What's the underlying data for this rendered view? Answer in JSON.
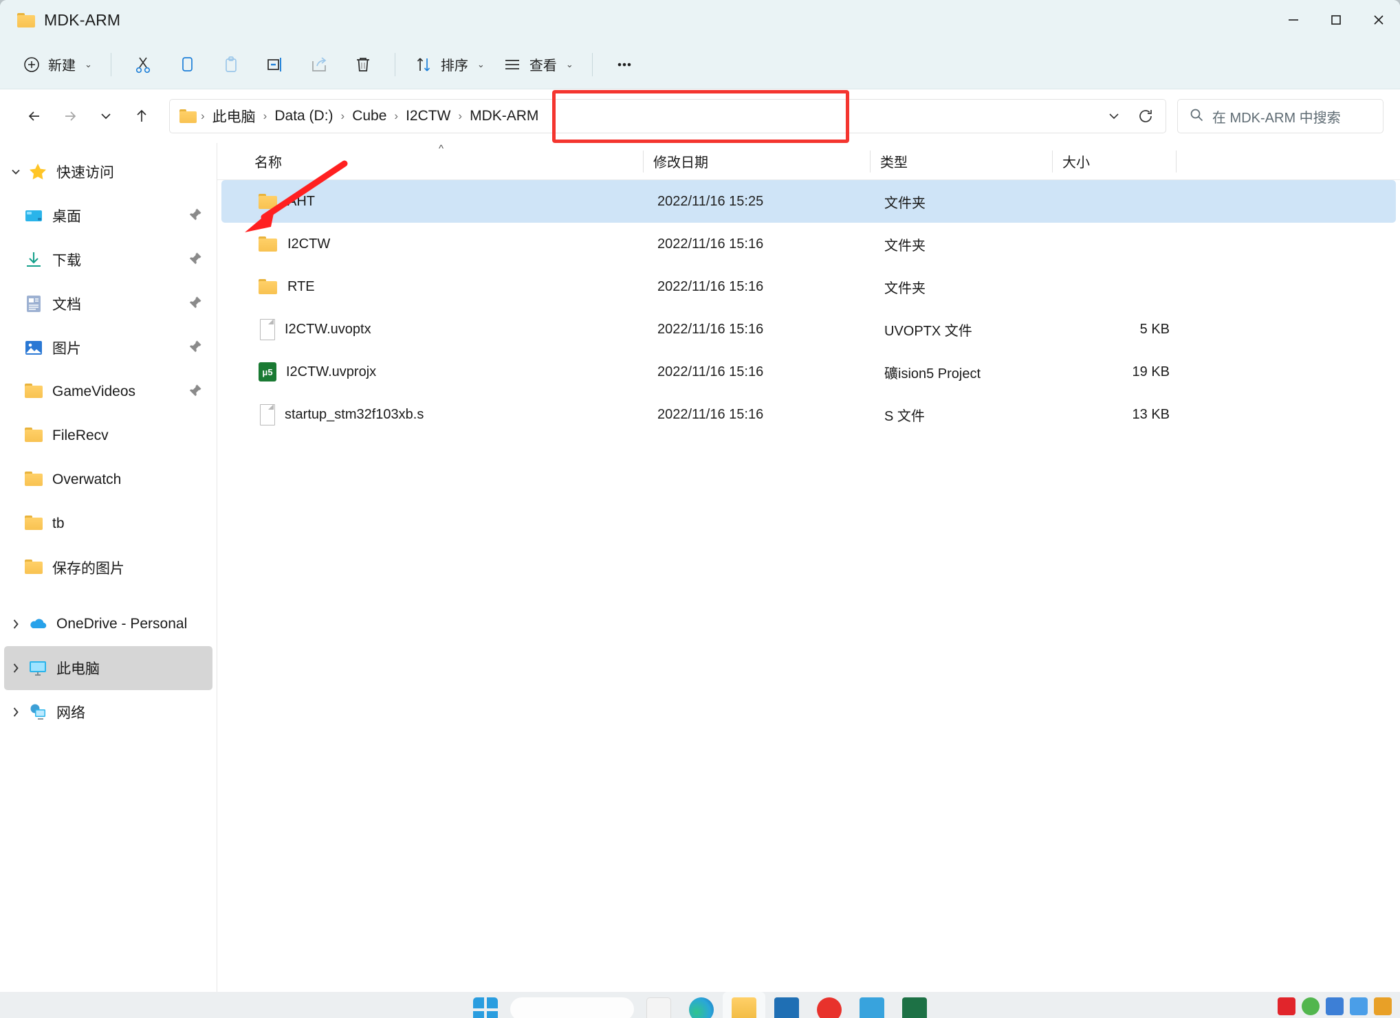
{
  "window": {
    "title": "MDK-ARM",
    "folder_icon": "folder-icon",
    "controls": {
      "minimize": "minimize-icon",
      "maximize": "maximize-icon",
      "close": "close-icon"
    }
  },
  "toolbar": {
    "new_label": "新建",
    "cut_label": "cut-icon",
    "copy_label": "copy-icon",
    "paste_label": "paste-icon",
    "rename_label": "rename-icon",
    "share_label": "share-icon",
    "delete_label": "delete-icon",
    "sort_label": "排序",
    "view_label": "查看",
    "more_label": "⋯"
  },
  "nav": {
    "back": "back-icon",
    "forward": "forward-icon",
    "recent": "recent-dropdown-icon",
    "up": "up-icon",
    "refresh": "refresh-icon",
    "dropdown": "address-dropdown-icon"
  },
  "address": {
    "crumbs": [
      "此电脑",
      "Data (D:)",
      "Cube",
      "I2CTW",
      "MDK-ARM"
    ],
    "separator": "›",
    "highlight_color": "#f4352f",
    "highlighted_crumbs": [
      "Cube",
      "I2CTW",
      "MDK-ARM"
    ]
  },
  "search": {
    "placeholder": "在 MDK-ARM 中搜索",
    "icon": "search-icon"
  },
  "sidebar": {
    "groups": [
      {
        "label": "快速访问",
        "icon": "star-icon",
        "expanded": true,
        "items": [
          {
            "label": "桌面",
            "icon": "desktop-icon",
            "pinned": true
          },
          {
            "label": "下载",
            "icon": "download-icon",
            "pinned": true
          },
          {
            "label": "文档",
            "icon": "document-icon",
            "pinned": true
          },
          {
            "label": "图片",
            "icon": "pictures-icon",
            "pinned": true
          },
          {
            "label": "GameVideos",
            "icon": "folder-icon",
            "pinned": true
          },
          {
            "label": "FileRecv",
            "icon": "folder-icon",
            "pinned": false
          },
          {
            "label": "Overwatch",
            "icon": "folder-icon",
            "pinned": false
          },
          {
            "label": "tb",
            "icon": "folder-icon",
            "pinned": false
          },
          {
            "label": "保存的图片",
            "icon": "folder-icon",
            "pinned": false
          }
        ]
      }
    ],
    "roots": [
      {
        "label": "OneDrive - Personal",
        "icon": "onedrive-icon",
        "selected": false
      },
      {
        "label": "此电脑",
        "icon": "this-pc-icon",
        "selected": true
      },
      {
        "label": "网络",
        "icon": "network-icon",
        "selected": false
      }
    ]
  },
  "filelist": {
    "columns": [
      "名称",
      "修改日期",
      "类型",
      "大小"
    ],
    "sort_indicator": "^",
    "rows": [
      {
        "name": "AHT",
        "icon": "folder-icon",
        "date": "2022/11/16 15:25",
        "type": "文件夹",
        "size": "",
        "selected": true
      },
      {
        "name": "I2CTW",
        "icon": "folder-icon",
        "date": "2022/11/16 15:16",
        "type": "文件夹",
        "size": "",
        "selected": false
      },
      {
        "name": "RTE",
        "icon": "folder-icon",
        "date": "2022/11/16 15:16",
        "type": "文件夹",
        "size": "",
        "selected": false
      },
      {
        "name": "I2CTW.uvoptx",
        "icon": "file-icon",
        "date": "2022/11/16 15:16",
        "type": "UVOPTX 文件",
        "size": "5 KB",
        "selected": false
      },
      {
        "name": "I2CTW.uvprojx",
        "icon": "uvision-icon",
        "date": "2022/11/16 15:16",
        "type": "礦ision5 Project",
        "size": "19 KB",
        "selected": false
      },
      {
        "name": "startup_stm32f103xb.s",
        "icon": "file-icon",
        "date": "2022/11/16 15:16",
        "type": "S 文件",
        "size": "13 KB",
        "selected": false
      }
    ]
  },
  "annotation": {
    "arrow_color": "#ff2020",
    "arrow_target": "AHT"
  },
  "taskbar": {
    "items": [
      {
        "name": "start-button",
        "color": "#2a9ddf"
      },
      {
        "name": "search-pill",
        "color": "#ffffff"
      },
      {
        "name": "widgets-button",
        "color": "#f2f2f2"
      },
      {
        "name": "edge-button",
        "color": "#2aa7d8"
      },
      {
        "name": "explorer-button",
        "color": "#f6c34a",
        "active": true
      },
      {
        "name": "store-button",
        "color": "#1f6fb4"
      },
      {
        "name": "opera-button",
        "color": "#e8322c"
      },
      {
        "name": "terminal-button",
        "color": "#38a3dd"
      },
      {
        "name": "excel-button",
        "color": "#1d7145"
      }
    ],
    "tray": [
      {
        "name": "tray-app-1",
        "color": "#e1252b"
      },
      {
        "name": "tray-app-2",
        "color": "#52b64e"
      },
      {
        "name": "tray-app-3",
        "color": "#3d7fd6"
      },
      {
        "name": "tray-app-4",
        "color": "#4a9ee8"
      },
      {
        "name": "tray-app-5",
        "color": "#e8a027"
      }
    ]
  }
}
